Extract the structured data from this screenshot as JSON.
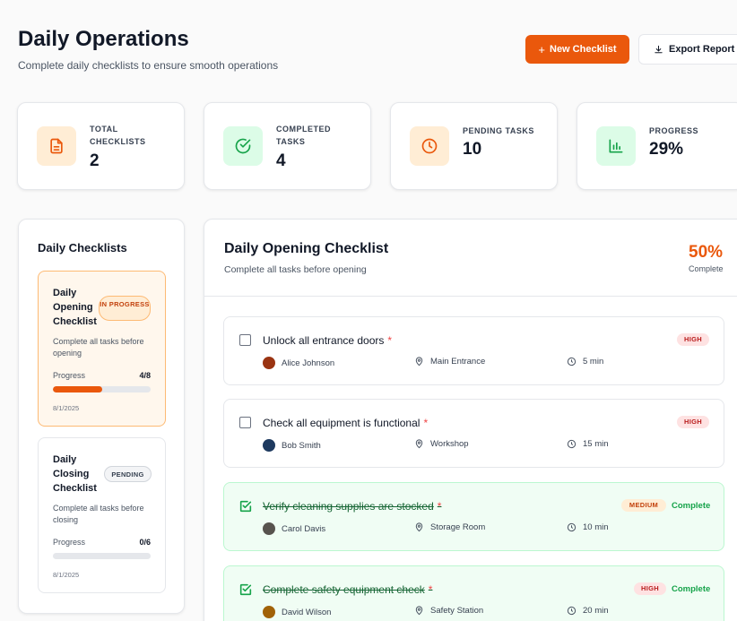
{
  "header": {
    "title": "Daily Operations",
    "subtitle": "Complete daily checklists to ensure smooth operations",
    "new_checklist": "New Checklist",
    "export_report": "Export Report"
  },
  "stats": [
    {
      "label": "TOTAL CHECKLISTS",
      "value": "2",
      "icon": "document-icon",
      "color": "#ea580c",
      "bg": "#ffedd5"
    },
    {
      "label": "COMPLETED TASKS",
      "value": "4",
      "icon": "check-circle-icon",
      "color": "#16a34a",
      "bg": "#dcfce7"
    },
    {
      "label": "PENDING TASKS",
      "value": "10",
      "icon": "clock-icon",
      "color": "#ea580c",
      "bg": "#ffedd5"
    },
    {
      "label": "PROGRESS",
      "value": "29%",
      "icon": "bar-chart-icon",
      "color": "#16a34a",
      "bg": "#dcfce7"
    }
  ],
  "sidebar": {
    "title": "Daily Checklists",
    "checklists": [
      {
        "name": "Daily Opening Checklist",
        "status": "IN PROGRESS",
        "description": "Complete all tasks before opening",
        "progress_label": "Progress",
        "progress_count": "4/8",
        "progress": 0.5,
        "date": "8/1/2025"
      },
      {
        "name": "Daily Closing Checklist",
        "status": "PENDING",
        "description": "Complete all tasks before closing",
        "progress_label": "Progress",
        "progress_count": "0/6",
        "progress": 0,
        "date": "8/1/2025"
      }
    ]
  },
  "main": {
    "title": "Daily Opening Checklist",
    "subtitle": "Complete all tasks before opening",
    "percent": "50%",
    "percent_label": "Complete",
    "tasks": [
      {
        "title": "Unlock all entrance doors",
        "required": "*",
        "priority": "HIGH",
        "assignee": "Alice Johnson",
        "location": "Main Entrance",
        "duration": "5 min",
        "done": false,
        "avatar_color": "#9a3412"
      },
      {
        "title": "Check all equipment is functional",
        "required": "*",
        "priority": "HIGH",
        "assignee": "Bob Smith",
        "location": "Workshop",
        "duration": "15 min",
        "done": false,
        "avatar_color": "#1e3a5f"
      },
      {
        "title": "Verify cleaning supplies are stocked",
        "required": "*",
        "priority": "MEDIUM",
        "assignee": "Carol Davis",
        "location": "Storage Room",
        "duration": "10 min",
        "done": true,
        "status": "Complete",
        "avatar_color": "#57534e"
      },
      {
        "title": "Complete safety equipment check",
        "required": "*",
        "priority": "HIGH",
        "assignee": "David Wilson",
        "location": "Safety Station",
        "duration": "20 min",
        "done": true,
        "status": "Complete",
        "avatar_color": "#a16207"
      }
    ]
  }
}
